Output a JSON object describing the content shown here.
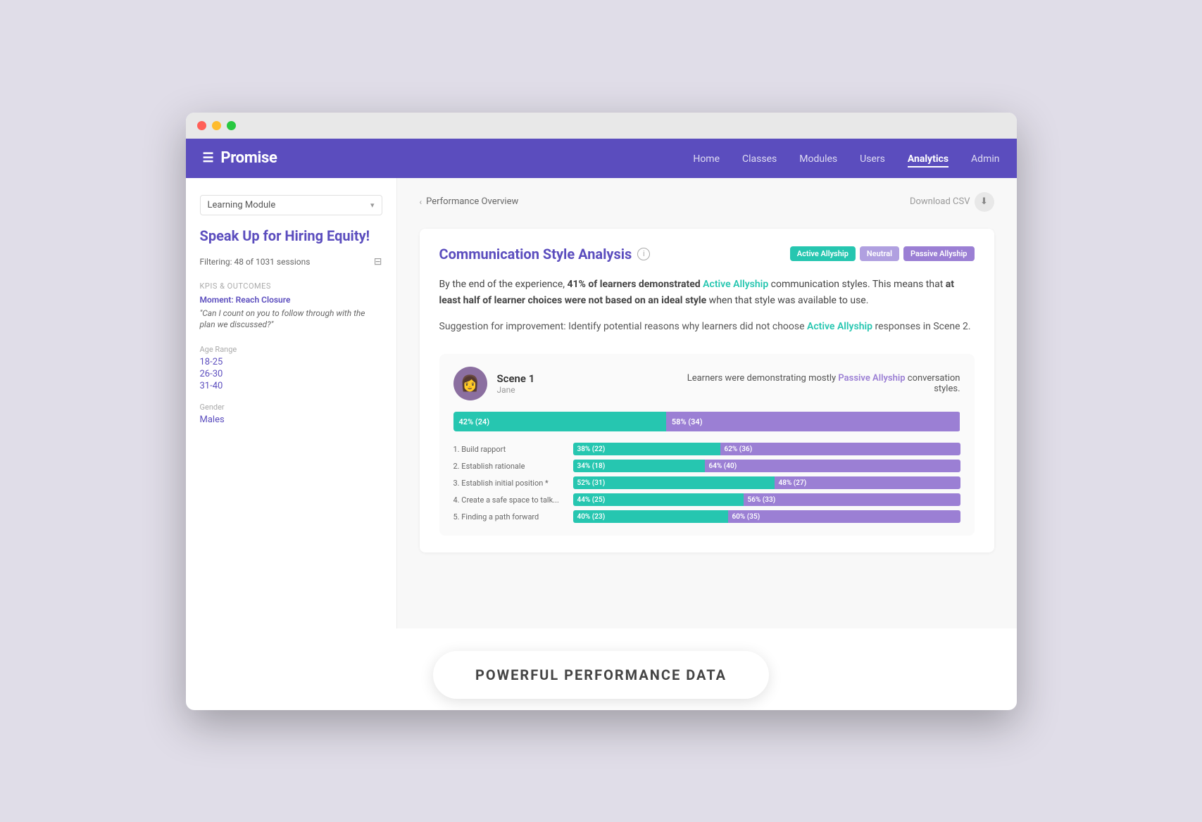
{
  "browser": {
    "dots": [
      "red",
      "yellow",
      "green"
    ]
  },
  "nav": {
    "menu_icon": "☰",
    "brand": "Promise",
    "links": [
      {
        "label": "Home",
        "active": false
      },
      {
        "label": "Classes",
        "active": false
      },
      {
        "label": "Modules",
        "active": false
      },
      {
        "label": "Users",
        "active": false
      },
      {
        "label": "Analytics",
        "active": true
      },
      {
        "label": "Admin",
        "active": false
      }
    ]
  },
  "sidebar": {
    "module_dropdown": "Learning Module",
    "module_title": "Speak Up for Hiring Equity!",
    "filter_text": "Filtering: 48 of 1031 sessions",
    "kpi_section": "KPIs & Outcomes",
    "kpi_link": "Moment: Reach Closure",
    "kpi_quote": "\"Can I count on you to follow through with the plan we discussed?\"",
    "age_range_label": "Age Range",
    "age_ranges": [
      "18-25",
      "26-30",
      "31-40"
    ],
    "gender_label": "Gender",
    "gender_value": "Males"
  },
  "content": {
    "breadcrumb": "Performance Overview",
    "download_csv": "Download CSV",
    "analysis_title": "Communication Style Analysis",
    "badges": [
      {
        "label": "Active Allyship",
        "type": "active"
      },
      {
        "label": "Neutral",
        "type": "neutral"
      },
      {
        "label": "Passive Allyship",
        "type": "passive"
      }
    ],
    "analysis_paragraph": {
      "prefix": "By the end of the experience, ",
      "bold1": "41% of learners demonstrated ",
      "link1": "Active Allyship",
      "mid": " communication styles. This means that ",
      "bold2": "at least half of learner choices were not based on an ideal style",
      "suffix": " when that style was available to use."
    },
    "suggestion": {
      "prefix": "Suggestion for improvement: Identify potential reasons why learners did not choose ",
      "link": "Active Allyship",
      "suffix": " responses in Scene 2."
    },
    "scene": {
      "name": "Scene 1",
      "character": "Jane",
      "description": "Learners were demonstrating mostly ",
      "description_link": "Passive Allyship",
      "description_suffix": " conversation styles.",
      "main_bar": {
        "teal_pct": 42,
        "purple_pct": 58,
        "teal_label": "42% (24)",
        "purple_label": "58% (34)"
      },
      "sub_bars": [
        {
          "label": "1. Build rapport",
          "teal": 38,
          "purple": 62,
          "teal_label": "38% (22)",
          "purple_label": "62% (36)"
        },
        {
          "label": "2. Establish rationale",
          "teal": 34,
          "purple": 66,
          "teal_label": "34% (18)",
          "purple_label": "64% (40)"
        },
        {
          "label": "3. Establish initial position *",
          "teal": 52,
          "purple": 48,
          "teal_label": "52% (31)",
          "purple_label": "48% (27)"
        },
        {
          "label": "4. Create a safe space to talk...",
          "teal": 44,
          "purple": 56,
          "teal_label": "44% (25)",
          "purple_label": "56% (33)"
        },
        {
          "label": "5. Finding a path forward",
          "teal": 40,
          "purple": 60,
          "teal_label": "40% (23)",
          "purple_label": "60% (35)"
        }
      ]
    }
  },
  "banner": {
    "text": "POWERFUL PERFORMANCE DATA"
  }
}
